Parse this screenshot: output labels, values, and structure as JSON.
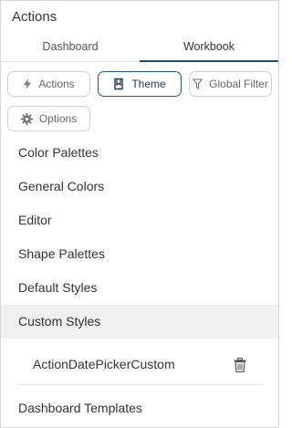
{
  "header": {
    "title": "Actions"
  },
  "tabs": [
    {
      "label": "Dashboard"
    },
    {
      "label": "Workbook",
      "active": true
    }
  ],
  "toolbar": {
    "actions_label": "Actions",
    "theme_label": "Theme",
    "global_filter_label": "Global Filter",
    "options_label": "Options",
    "active": "Theme"
  },
  "sections": [
    {
      "label": "Color Palettes"
    },
    {
      "label": "General Colors"
    },
    {
      "label": "Editor"
    },
    {
      "label": "Shape Palettes"
    },
    {
      "label": "Default Styles"
    },
    {
      "label": "Custom Styles",
      "expanded": true
    },
    {
      "label": "Dashboard Templates"
    }
  ],
  "custom_styles": [
    {
      "label": "ActionDatePickerCustom",
      "action_icon": "trash-icon"
    }
  ],
  "colors": {
    "accent": "#1f4e6e",
    "expanded_bg": "#f0f0f0"
  }
}
